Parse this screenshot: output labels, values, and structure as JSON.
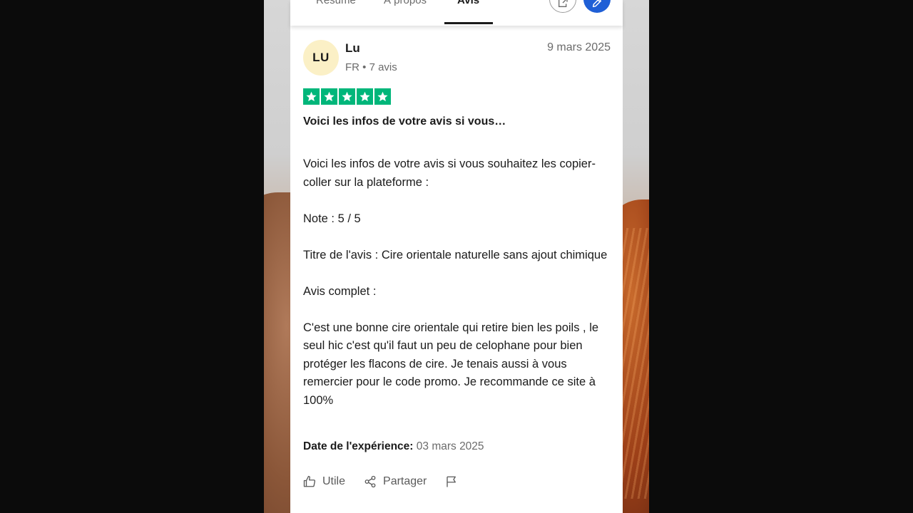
{
  "tabs": [
    {
      "label": "Résumé"
    },
    {
      "label": "À propos"
    },
    {
      "label": "Avis",
      "active": true
    }
  ],
  "toolbar": {
    "share_icon": "share-out-icon",
    "edit_icon": "pencil-icon",
    "accent_color": "#1f5fd6"
  },
  "review": {
    "avatar_initials": "LU",
    "reviewer_name": "Lu",
    "reviewer_meta": "FR • 7 avis",
    "date": "9 mars 2025",
    "rating": 5,
    "rating_color": "#00b67a",
    "title": "Voici les infos de votre avis si vous…",
    "body": [
      "Voici les infos de votre avis si vous souhaitez les copier-coller sur la plateforme :",
      "Note : 5 / 5",
      "Titre de l'avis : Cire orientale naturelle sans ajout chimique",
      "Avis complet :",
      "C'est une bonne cire orientale qui retire bien les poils , le seul hic c'est qu'il faut un peu de celophane pour bien protéger les flacons de cire. Je tenais aussi à vous remercier pour le code promo. Je recommande ce site à 100%"
    ],
    "experience_label": "Date de l'expérience:",
    "experience_date": "03 mars 2025"
  },
  "actions": {
    "useful_label": "Utile",
    "share_label": "Partager",
    "flag_icon": "flag-icon"
  }
}
